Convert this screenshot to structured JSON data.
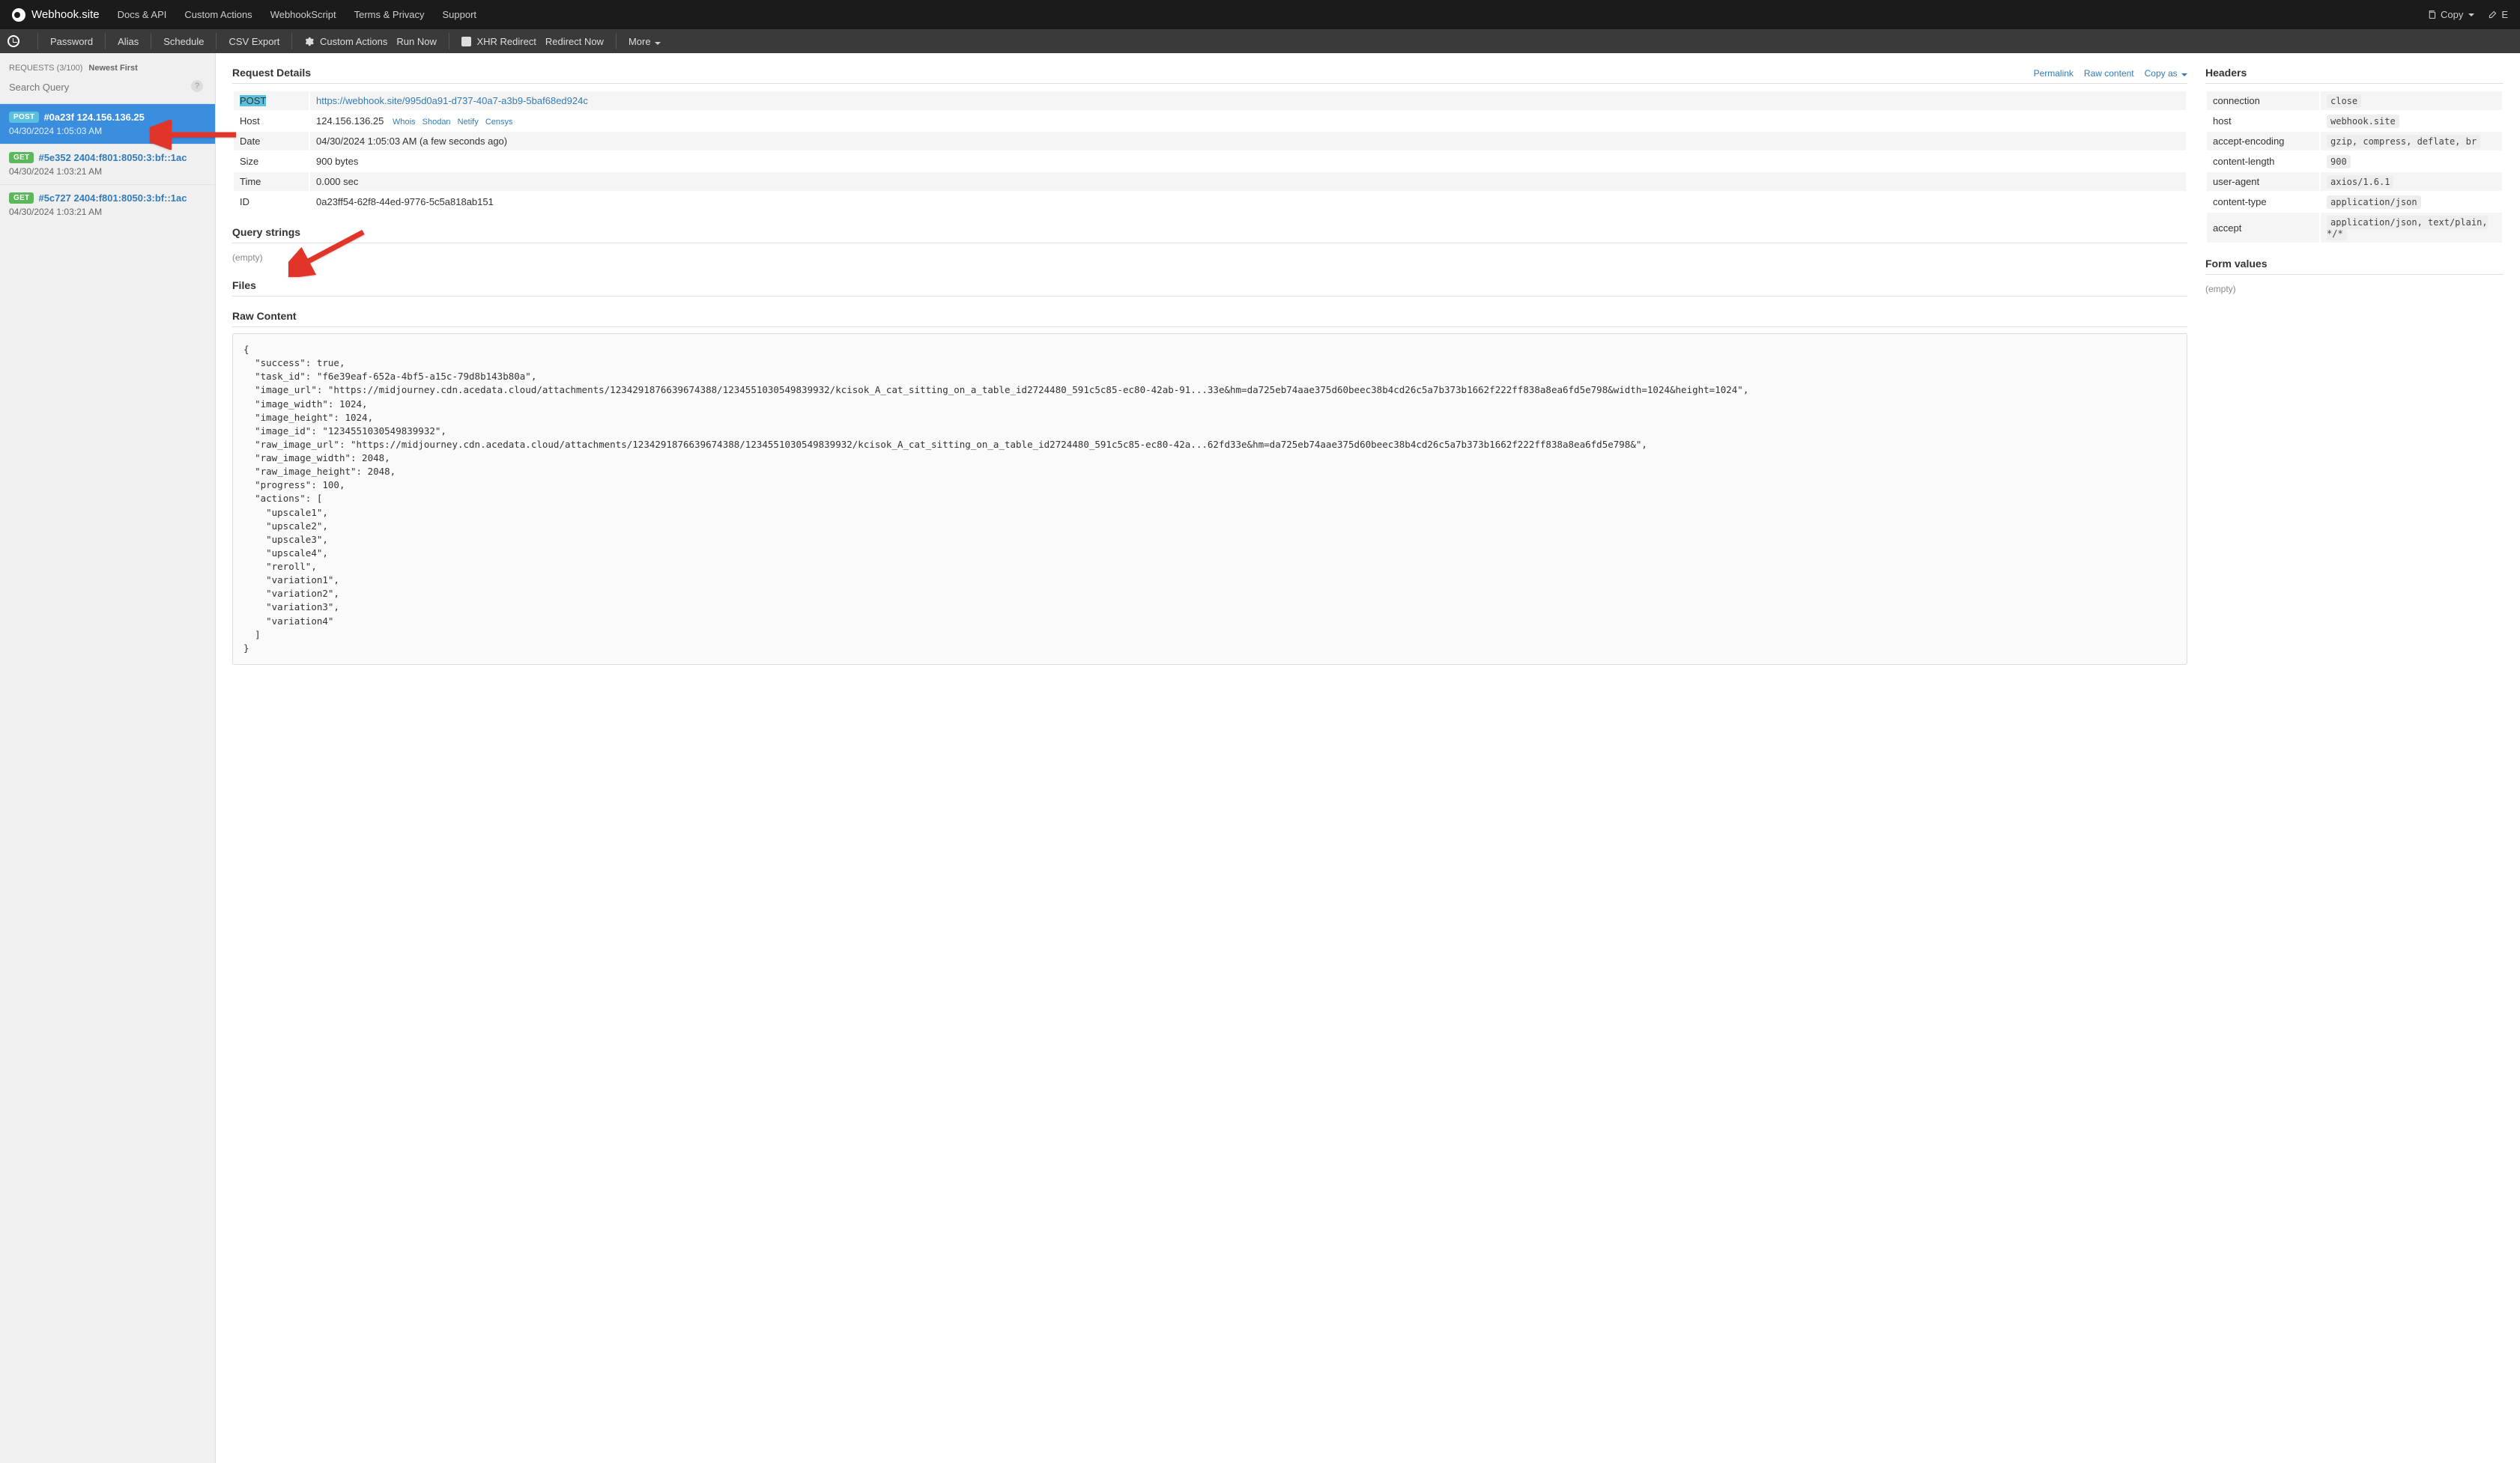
{
  "brand": "Webhook.site",
  "topnav": {
    "links": [
      "Docs & API",
      "Custom Actions",
      "WebhookScript",
      "Terms & Privacy",
      "Support"
    ],
    "right": {
      "copy": "Copy",
      "edit": "E"
    }
  },
  "toolbar": {
    "password": "Password",
    "alias": "Alias",
    "schedule": "Schedule",
    "csv": "CSV Export",
    "custom_actions": "Custom Actions",
    "run_now": "Run Now",
    "xhr": "XHR Redirect",
    "redirect_now": "Redirect Now",
    "more": "More"
  },
  "sidebar": {
    "counter_label": "REQUESTS (3/100)",
    "sort": "Newest First",
    "search_placeholder": "Search Query",
    "items": [
      {
        "method": "POST",
        "hash": "#0a23f",
        "addr": "124.156.136.25",
        "ts": "04/30/2024 1:05:03 AM",
        "selected": true
      },
      {
        "method": "GET",
        "hash": "#5e352",
        "addr": "2404:f801:8050:3:bf::1ac",
        "ts": "04/30/2024 1:03:21 AM",
        "selected": false
      },
      {
        "method": "GET",
        "hash": "#5c727",
        "addr": "2404:f801:8050:3:bf::1ac",
        "ts": "04/30/2024 1:03:21 AM",
        "selected": false
      }
    ]
  },
  "details": {
    "title": "Request Details",
    "actions": {
      "permalink": "Permalink",
      "raw": "Raw content",
      "copyas": "Copy as"
    },
    "rows": {
      "method": "POST",
      "url": "https://webhook.site/995d0a91-d737-40a7-a3b9-5baf68ed924c",
      "host_label": "Host",
      "host": "124.156.136.25",
      "hostlinks": [
        "Whois",
        "Shodan",
        "Netify",
        "Censys"
      ],
      "date_label": "Date",
      "date": "04/30/2024 1:05:03 AM (a few seconds ago)",
      "size_label": "Size",
      "size": "900 bytes",
      "time_label": "Time",
      "time": "0.000 sec",
      "id_label": "ID",
      "id": "0a23ff54-62f8-44ed-9776-5c5a818ab151"
    }
  },
  "query": {
    "title": "Query strings",
    "empty": "(empty)"
  },
  "files": {
    "title": "Files"
  },
  "raw": {
    "title": "Raw Content",
    "body": "{\n  \"success\": true,\n  \"task_id\": \"f6e39eaf-652a-4bf5-a15c-79d8b143b80a\",\n  \"image_url\": \"https://midjourney.cdn.acedata.cloud/attachments/1234291876639674388/1234551030549839932/kcisok_A_cat_sitting_on_a_table_id2724480_591c5c85-ec80-42ab-91...33e&hm=da725eb74aae375d60beec38b4cd26c5a7b373b1662f222ff838a8ea6fd5e798&width=1024&height=1024\",\n  \"image_width\": 1024,\n  \"image_height\": 1024,\n  \"image_id\": \"1234551030549839932\",\n  \"raw_image_url\": \"https://midjourney.cdn.acedata.cloud/attachments/1234291876639674388/1234551030549839932/kcisok_A_cat_sitting_on_a_table_id2724480_591c5c85-ec80-42a...62fd33e&hm=da725eb74aae375d60beec38b4cd26c5a7b373b1662f222ff838a8ea6fd5e798&\",\n  \"raw_image_width\": 2048,\n  \"raw_image_height\": 2048,\n  \"progress\": 100,\n  \"actions\": [\n    \"upscale1\",\n    \"upscale2\",\n    \"upscale3\",\n    \"upscale4\",\n    \"reroll\",\n    \"variation1\",\n    \"variation2\",\n    \"variation3\",\n    \"variation4\"\n  ]\n}"
  },
  "headers": {
    "title": "Headers",
    "rows": [
      {
        "k": "connection",
        "v": "close"
      },
      {
        "k": "host",
        "v": "webhook.site"
      },
      {
        "k": "accept-encoding",
        "v": "gzip, compress, deflate, br"
      },
      {
        "k": "content-length",
        "v": "900"
      },
      {
        "k": "user-agent",
        "v": "axios/1.6.1"
      },
      {
        "k": "content-type",
        "v": "application/json"
      },
      {
        "k": "accept",
        "v": "application/json, text/plain, */*"
      }
    ]
  },
  "form": {
    "title": "Form values",
    "empty": "(empty)"
  }
}
